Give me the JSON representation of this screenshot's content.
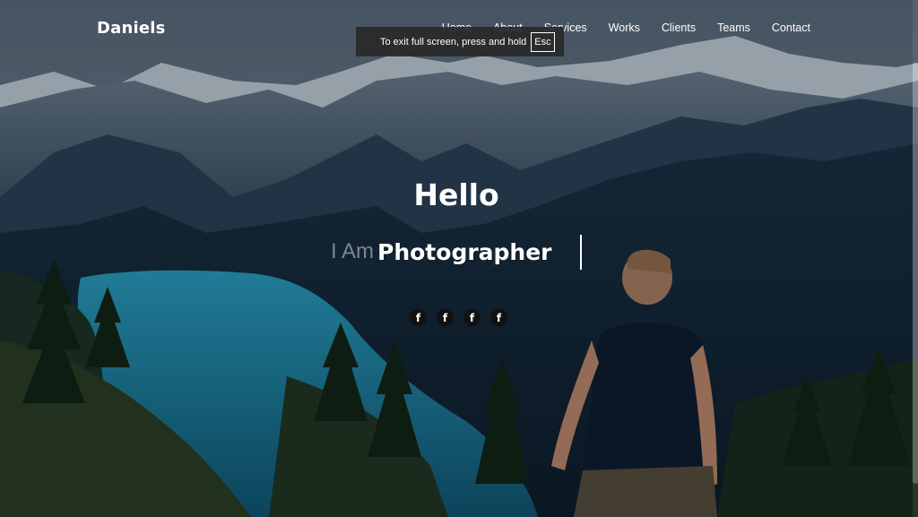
{
  "site": {
    "brand": "Daniels"
  },
  "nav": {
    "items": [
      {
        "label": "Home"
      },
      {
        "label": "About"
      },
      {
        "label": "Services"
      },
      {
        "label": "Works"
      },
      {
        "label": "Clients"
      },
      {
        "label": "Teams"
      },
      {
        "label": "Contact"
      }
    ]
  },
  "fullscreen_notice": {
    "text": "To exit full screen, press and hold",
    "key": "Esc"
  },
  "hero": {
    "greeting": "Hello",
    "prefix": "I Am",
    "role": "Photographer"
  },
  "social": [
    {
      "icon": "facebook-icon",
      "glyph": "f"
    },
    {
      "icon": "facebook-icon",
      "glyph": "f"
    },
    {
      "icon": "facebook-icon",
      "glyph": "f"
    },
    {
      "icon": "facebook-icon",
      "glyph": "f"
    }
  ],
  "colors": {
    "text": "#ffffff",
    "lake": "#1f8fb0",
    "sky": "#6b7d8c"
  }
}
